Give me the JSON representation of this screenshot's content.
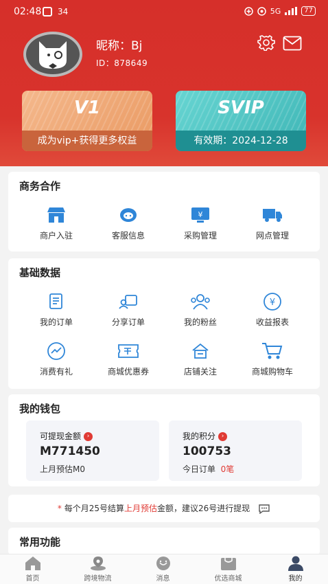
{
  "status": {
    "time": "02:48",
    "notif_count": "34",
    "signal_text": "5G",
    "battery": "77"
  },
  "profile": {
    "nickname": "昵称：Bj",
    "id": "ID：878649"
  },
  "vip_card": {
    "logo": "V1",
    "caption": "成为vip+获得更多权益"
  },
  "svip_card": {
    "logo": "SVIP",
    "caption": "有效期：2024-12-28"
  },
  "business": {
    "title": "商务合作",
    "items": [
      {
        "label": "商户入驻",
        "icon": "store-icon"
      },
      {
        "label": "客服信息",
        "icon": "headset-icon"
      },
      {
        "label": "采购管理",
        "icon": "purchase-icon"
      },
      {
        "label": "网点管理",
        "icon": "truck-icon"
      }
    ]
  },
  "basic": {
    "title": "基础数据",
    "items": [
      {
        "label": "我的订单",
        "icon": "order-icon"
      },
      {
        "label": "分享订单",
        "icon": "share-order-icon"
      },
      {
        "label": "我的粉丝",
        "icon": "fans-icon"
      },
      {
        "label": "收益报表",
        "icon": "income-icon"
      },
      {
        "label": "消费有礼",
        "icon": "trend-icon"
      },
      {
        "label": "商城优惠券",
        "icon": "coupon-icon"
      },
      {
        "label": "店铺关注",
        "icon": "shop-follow-icon"
      },
      {
        "label": "商城购物车",
        "icon": "cart-icon"
      }
    ]
  },
  "wallet": {
    "title": "我的钱包",
    "withdraw": {
      "label": "可提现金额",
      "value": "M771450",
      "sub": "上月预估M0"
    },
    "points": {
      "label": "我的积分",
      "value": "100753",
      "sub_prefix": "今日订单",
      "sub_value": "0笔"
    }
  },
  "notice": {
    "star": "*",
    "part1": "每个月25号结算",
    "highlight": "上月预估",
    "part2": "金额，建议26号进行提现"
  },
  "common": {
    "title": "常用功能"
  },
  "tabs": [
    {
      "label": "首页",
      "icon": "home-icon"
    },
    {
      "label": "跨境物流",
      "icon": "location-icon"
    },
    {
      "label": "消息",
      "icon": "message-icon"
    },
    {
      "label": "优选商城",
      "icon": "mall-icon"
    },
    {
      "label": "我的",
      "icon": "profile-icon"
    }
  ],
  "colors": {
    "primary_red": "#d62f2a",
    "icon_blue": "#2f86d8",
    "vip_orange": "#c9643c",
    "svip_teal": "#1f8f92"
  }
}
